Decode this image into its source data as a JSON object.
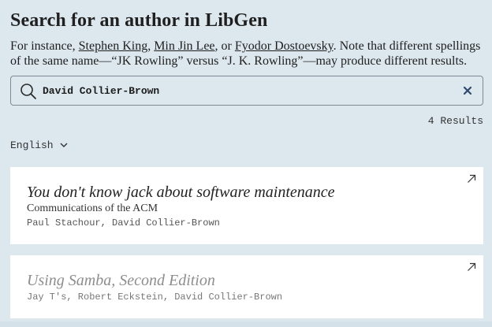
{
  "page": {
    "title": "Search for an author in LibGen",
    "intro": {
      "prefix": "For instance, ",
      "examples": [
        "Stephen King",
        "Min Jin Lee",
        "Fyodor Dostoevsky"
      ],
      "sep1": ", ",
      "sep2": ", or ",
      "suffix": ". Note that different spellings of the same name—“JK Rowling” versus “J. K. Rowling”—may produce different results."
    },
    "search": {
      "value": "David Collier-Brown",
      "search_icon": "search-icon",
      "clear_icon": "close-icon"
    },
    "results_count": "4 Results",
    "language_filter": {
      "selected": "English",
      "icon": "chevron-down-icon"
    },
    "results": [
      {
        "title": "You don't know jack about software maintenance",
        "venue": "Communications of the ACM",
        "authors": "Paul Stachour, David Collier-Brown"
      },
      {
        "title": "Using Samba, Second Edition",
        "authors": "Jay T's, Robert Eckstein, David Collier-Brown"
      }
    ]
  },
  "colors": {
    "background": "#dce7ee",
    "card": "#ffffff",
    "accent": "#2f4a6d",
    "muted_title": "#8d8d8d"
  }
}
